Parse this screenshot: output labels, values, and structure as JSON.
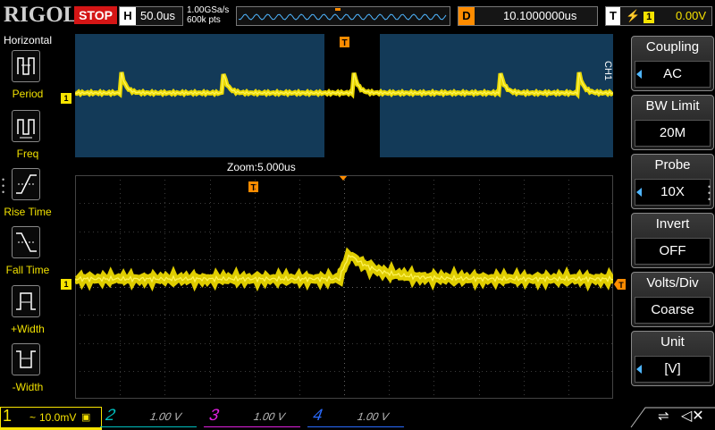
{
  "brand": "RIGOL",
  "run_state": "STOP",
  "horizontal": {
    "label": "H",
    "timebase": "50.0us"
  },
  "sample": {
    "rate": "1.00GSa/s",
    "points": "600k pts"
  },
  "delay": {
    "label": "D",
    "value": "10.1000000us"
  },
  "trigger": {
    "label": "T",
    "source": "1",
    "level": "0.00V",
    "marker": "T"
  },
  "left_menu": {
    "title": "Horizontal",
    "items": [
      {
        "label": "Period",
        "icon": "period-icon"
      },
      {
        "label": "Freq",
        "icon": "frequency-icon"
      },
      {
        "label": "Rise Time",
        "icon": "rise-time-icon"
      },
      {
        "label": "Fall Time",
        "icon": "fall-time-icon"
      },
      {
        "label": "+Width",
        "icon": "positive-width-icon"
      },
      {
        "label": "-Width",
        "icon": "negative-width-icon"
      }
    ]
  },
  "zoom_label": "Zoom:5.000us",
  "channel_marker": "1",
  "ch_tag": "CH1",
  "right_menu": [
    {
      "title": "Coupling",
      "value": "AC",
      "arrow": true
    },
    {
      "title": "BW Limit",
      "value": "20M",
      "arrow": false
    },
    {
      "title": "Probe",
      "value": "10X",
      "arrow": true
    },
    {
      "title": "Invert",
      "value": "OFF",
      "arrow": false
    },
    {
      "title": "Volts/Div",
      "value": "Coarse",
      "arrow": false
    },
    {
      "title": "Unit",
      "value": "[V]",
      "arrow": true
    }
  ],
  "channels": [
    {
      "num": "1",
      "scale": "10.0mV",
      "coupling_icon": "~",
      "color": "#f7e300",
      "active": true
    },
    {
      "num": "2",
      "scale": "1.00 V",
      "color": "#00c0c0",
      "active": false
    },
    {
      "num": "3",
      "scale": "1.00 V",
      "color": "#e020e0",
      "active": false
    },
    {
      "num": "4",
      "scale": "1.00 V",
      "color": "#2a6bff",
      "active": false
    }
  ],
  "colors": {
    "trace": "#f7e300",
    "overview_bg": "#133a58",
    "trigger_marker": "#ff8c00",
    "stop": "#d41515"
  }
}
